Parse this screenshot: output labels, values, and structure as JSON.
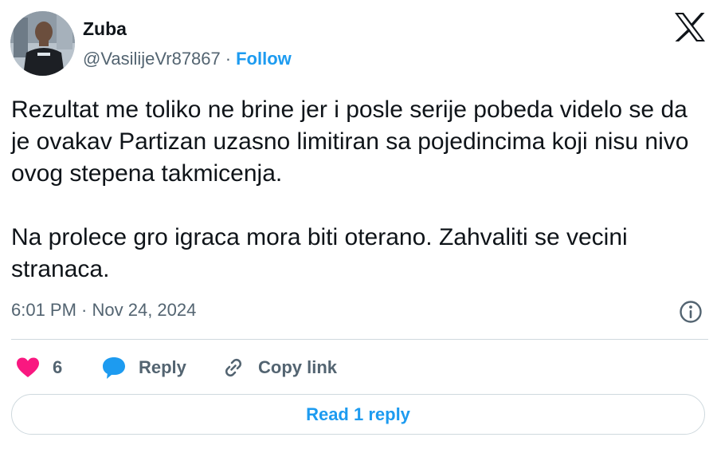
{
  "author": {
    "name": "Zuba",
    "handle": "@VasilijeVr87867",
    "separator": "·",
    "follow_label": "Follow"
  },
  "tweet": {
    "paragraphs": [
      "Rezultat me toliko ne brine jer i posle serije pobeda videlo se da je ovakav Partizan uzasno limitiran sa pojedincima koji nisu nivo ovog stepena takmicenja.",
      "Na prolece gro igraca mora biti oterano. Zahvaliti se vecini stranaca."
    ],
    "timestamp": "6:01 PM · Nov 24, 2024"
  },
  "actions": {
    "like_count": "6",
    "reply_label": "Reply",
    "copy_link_label": "Copy link"
  },
  "read_reply_label": "Read 1 reply",
  "icons": {
    "brand": "x-logo-icon",
    "info": "info-icon",
    "like": "heart-icon",
    "reply": "speech-bubble-icon",
    "copy": "link-icon"
  },
  "colors": {
    "accent": "#1d9bf0",
    "like": "#f91880",
    "text": "#0f1419",
    "muted": "#536471",
    "border": "#cfd9de"
  }
}
